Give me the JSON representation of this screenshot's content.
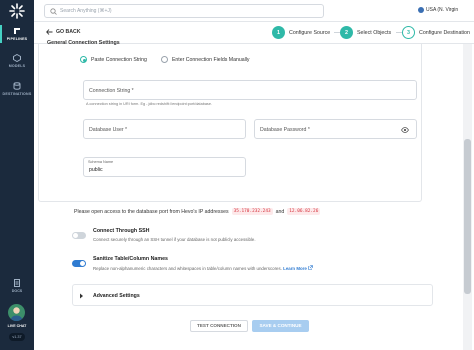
{
  "sidebar": {
    "items": [
      {
        "label": "PIPELINES"
      },
      {
        "label": "MODELS"
      },
      {
        "label": "DESTINATIONS"
      }
    ],
    "docs_label": "DOCS",
    "live_chat_label": "LIVE CHAT",
    "version": "v1.37"
  },
  "topbar": {
    "search_placeholder": "Search Anything  (⌘+J)",
    "region": "USA (N. Virgin"
  },
  "header": {
    "go_back": "GO BACK",
    "steps": [
      {
        "number": "1",
        "label": "Configure Source",
        "state": "done"
      },
      {
        "number": "2",
        "label": "Select Objects",
        "state": "done"
      },
      {
        "number": "3",
        "label": "Configure Destination",
        "state": "current"
      }
    ]
  },
  "form": {
    "section_title": "General Connection Settings",
    "radio_options": [
      {
        "label": "Paste Connection String",
        "selected": true
      },
      {
        "label": "Enter Connection Fields Manually",
        "selected": false
      }
    ],
    "connection_string_placeholder": "Connection String *",
    "connection_string_hint": "A connection string in URI form. Eg - jdbc:redshift://endpoint:port/database.",
    "db_user_placeholder": "Database User *",
    "db_password_placeholder": "Database Password *",
    "schema_label": "Schema Name",
    "schema_value": "public"
  },
  "ip_access": {
    "text": "Please open access to the database port from Hevo's IP addresses",
    "ips": [
      "35.170.232.243",
      "12.06.82.26"
    ],
    "and": "and"
  },
  "options": [
    {
      "title": "Connect Through SSH",
      "desc": "Connect securely through an SSH tunnel if your database is not publicly accessible.",
      "enabled": false
    },
    {
      "title": "Sanitize Table/Column Names",
      "desc": "Replace non-alphanumeric characters and whitespaces in table/column names with underscores.",
      "learn_more": "Learn More",
      "enabled": true
    }
  ],
  "advanced": {
    "label": "Advanced Settings"
  },
  "buttons": {
    "test": "TEST CONNECTION",
    "save": "SAVE & CONTINUE"
  },
  "colors": {
    "accent": "#2fb9a8",
    "sidebar": "#1b2a3d",
    "link": "#2f7bd1",
    "ip_badge": "#d6323d"
  }
}
